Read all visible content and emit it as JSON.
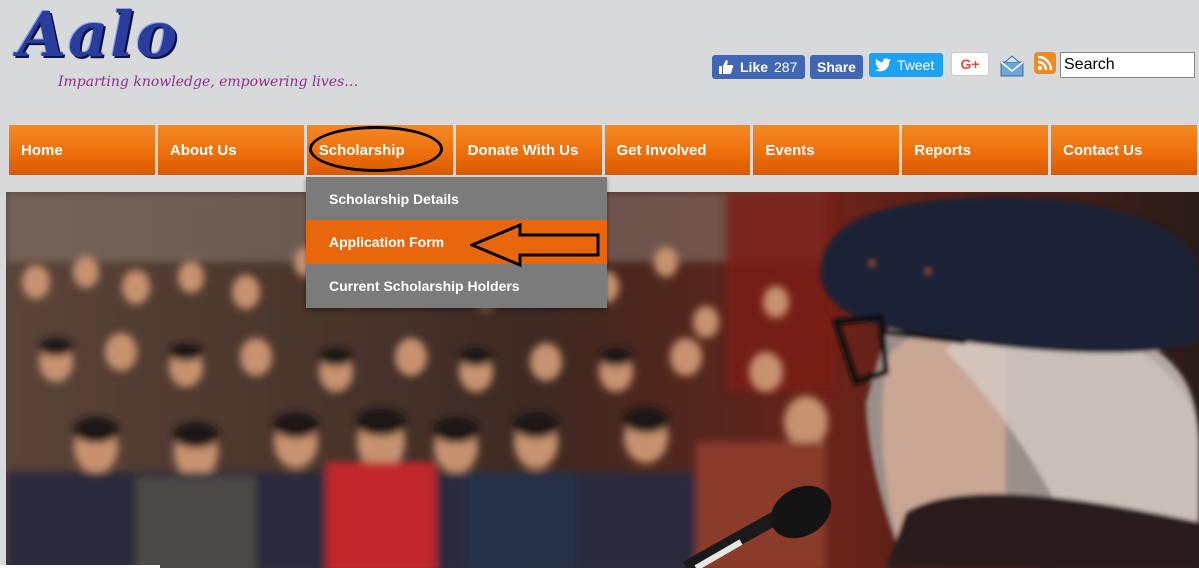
{
  "logo": {
    "title": "Aalo",
    "tagline": "Imparting knowledge, empowering lives…"
  },
  "social": {
    "fb_like_label": "Like",
    "fb_like_count": "287",
    "fb_share_label": "Share",
    "tweet_label": "Tweet",
    "gplus_label": "G+",
    "mail_icon": "mail-icon",
    "rss_icon": "rss-icon"
  },
  "search": {
    "placeholder": "Search"
  },
  "nav": {
    "items": [
      {
        "label": "Home"
      },
      {
        "label": "About Us"
      },
      {
        "label": "Scholarship"
      },
      {
        "label": "Donate With Us"
      },
      {
        "label": "Get Involved"
      },
      {
        "label": "Events"
      },
      {
        "label": "Reports"
      },
      {
        "label": "Contact Us"
      }
    ]
  },
  "dropdown": {
    "items": [
      {
        "label": "Scholarship Details"
      },
      {
        "label": "Application Form"
      },
      {
        "label": "Current Scholarship Holders"
      }
    ]
  },
  "colors": {
    "nav_orange": "#ee6f0a",
    "dropdown_gray": "#7b7b7b",
    "dropdown_active": "#e8670c",
    "facebook_blue": "#4267b2",
    "twitter_blue": "#1da1f2",
    "logo_blue": "#2a3c9c",
    "tagline_purple": "#8e2f8e"
  }
}
